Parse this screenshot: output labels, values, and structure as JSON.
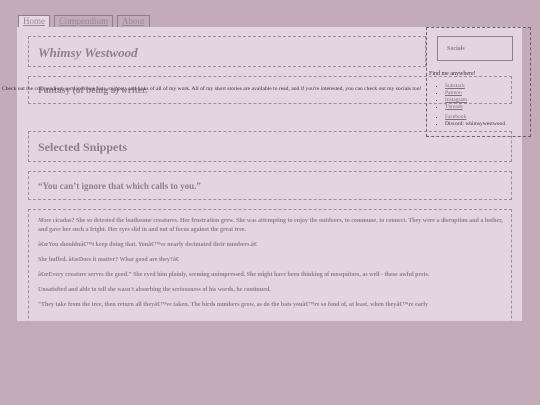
{
  "nav": {
    "tabs": [
      {
        "label": "Home"
      },
      {
        "label": "Compendium"
      },
      {
        "label": "About"
      }
    ]
  },
  "header": {
    "site_title": "Whimsy Westwood",
    "tagline": "Fantasy (of being a) writer.",
    "intro": "Check out the compendium section to see lists, snippets and links of all of my work. All of my short stories are available to read, and if you're interested, you can check out my socials too!"
  },
  "sidebar": {
    "heading": "Socials",
    "find_me": "Find me anywhere!",
    "links": [
      {
        "label": "Substack"
      },
      {
        "label": "Patreon"
      },
      {
        "label": "Instagram"
      },
      {
        "label": "Threads"
      },
      {
        "label": "Facebook"
      }
    ],
    "discord": "Discord: whimsywestwood"
  },
  "main": {
    "section_heading": "Selected Snippets",
    "quote": "“You can’t ignore that which calls to you.”",
    "story": {
      "first_word": "More",
      "p1_rest": " cicadas? She so detested the loathsome creatures. Her frustration grew. She was attempting to enjoy the outdoors, to commune, to connect. They were a disruption and a bother, and gave her such a fright. Her eyes slid in and out of focus against the great tree.",
      "p2": "â€œYou shouldnâ€™t keep doing that. Youâ€™ve nearly decimated their numbers.â€",
      "p3": "She huffed. â€œDoes it matter? What good are they?â€",
      "p4": "â€œEvery creature serves the good.” She eyed him plainly, seeming unimpressed. She might have been thinking of mosquitoes, as well - those awful pests.",
      "p5": "Unsatisfied and able to tell she wasn't absorbing the seriousness of his words, he continued.",
      "p6": "“They take from the tree, then return all theyâ€™ve taken. The birds numbers grow, as do the bats youâ€™re so fond of, at least, when theyâ€™re early"
    }
  }
}
